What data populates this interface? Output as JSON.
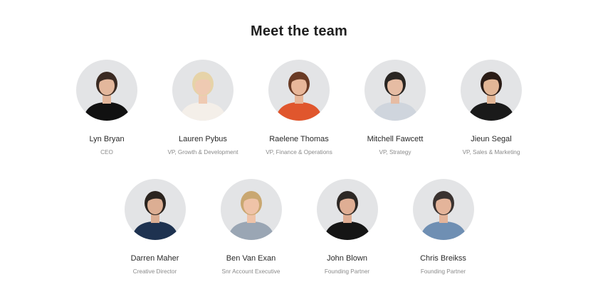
{
  "heading": "Meet the team",
  "team_row_1": [
    {
      "name": "Lyn Bryan",
      "role": "CEO",
      "icon": "person-photo-icon",
      "hair": "#3a2a22",
      "shirt": "#111111",
      "skin": "#e3b79c"
    },
    {
      "name": "Lauren Pybus",
      "role": "VP, Growth & Development",
      "icon": "person-photo-icon",
      "hair": "#e6d3a8",
      "shirt": "#f4efe9",
      "skin": "#efcab2"
    },
    {
      "name": "Raelene Thomas",
      "role": "VP, Finance & Operations",
      "icon": "person-photo-icon",
      "hair": "#6a3b25",
      "shirt": "#e0562d",
      "skin": "#e8b79a"
    },
    {
      "name": "Mitchell Fawcett",
      "role": "VP, Strategy",
      "icon": "person-photo-icon",
      "hair": "#2a2623",
      "shirt": "#cfd5dd",
      "skin": "#e6bca3"
    },
    {
      "name": "Jieun Segal",
      "role": "VP, Sales & Marketing",
      "icon": "person-photo-icon",
      "hair": "#2a1c16",
      "shirt": "#1a1a1a",
      "skin": "#e2b696"
    }
  ],
  "team_row_2": [
    {
      "name": "Darren Maher",
      "role": "Creative Director",
      "icon": "person-photo-icon",
      "hair": "#2b241f",
      "shirt": "#1e3250",
      "skin": "#dcae93"
    },
    {
      "name": "Ben Van Exan",
      "role": "Snr Account Executive",
      "icon": "person-photo-icon",
      "hair": "#c9a771",
      "shirt": "#9aa6b4",
      "skin": "#efc3a8"
    },
    {
      "name": "John Blown",
      "role": "Founding Partner",
      "icon": "person-photo-icon",
      "hair": "#2d2825",
      "shirt": "#151515",
      "skin": "#dfae94"
    },
    {
      "name": "Chris Breikss",
      "role": "Founding Partner",
      "icon": "person-photo-icon",
      "hair": "#3a3230",
      "shirt": "#6f8fb3",
      "skin": "#e4b49a"
    }
  ]
}
